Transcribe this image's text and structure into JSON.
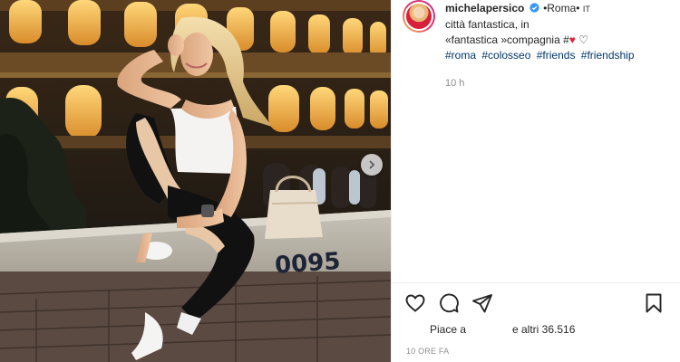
{
  "post": {
    "username": "michelapersico",
    "location": "•Roma•",
    "location_suffix": "IT",
    "caption_line1": "città fantastica, in",
    "caption_line2": "«fantastica »compagnia #",
    "hashtags": [
      "#roma",
      "#colosseo",
      "#friends",
      "#friendship"
    ],
    "time_ago": "10 h",
    "likes_prefix": "Piace a",
    "likes_suffix": "e altri 36.516",
    "post_age": "10 ORE FA"
  },
  "photo": {
    "wall_sign": "0095"
  },
  "icons": {
    "like": "heart-outline-icon",
    "comment": "comment-bubble-icon",
    "share": "paper-plane-icon",
    "save": "bookmark-icon",
    "verified": "verified-badge-icon",
    "next": "chevron-right-icon"
  },
  "colors": {
    "link": "#00376b",
    "muted": "#8e8e8e",
    "verified": "#3897f0",
    "heart": "#e0243b"
  }
}
